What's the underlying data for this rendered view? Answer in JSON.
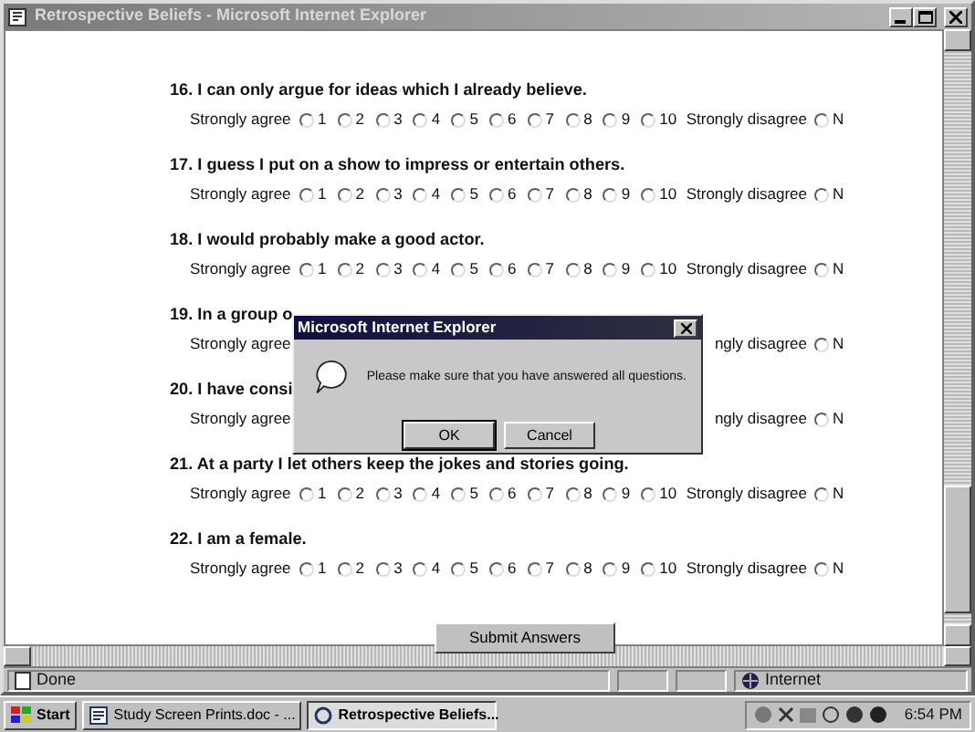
{
  "window": {
    "title": "Retrospective Beliefs - Microsoft Internet Explorer"
  },
  "questions": [
    {
      "heading": "16. I can only argue for ideas which I already believe.",
      "left_label": "Strongly agree",
      "options": [
        {
          "label": "1",
          "selected": false
        },
        {
          "label": "2",
          "selected": false
        },
        {
          "label": "3",
          "selected": false
        },
        {
          "label": "4",
          "selected": false
        },
        {
          "label": "5",
          "selected": false
        },
        {
          "label": "6",
          "selected": false
        },
        {
          "label": "7",
          "selected": false
        },
        {
          "label": "8",
          "selected": false
        },
        {
          "label": "9",
          "selected": false
        },
        {
          "label": "10",
          "selected": false
        }
      ],
      "right_label": "Strongly disagree",
      "extra_option": {
        "label": "N",
        "selected": false
      }
    },
    {
      "heading": "17. I guess I put on a show to impress or entertain others.",
      "left_label": "Strongly agree",
      "options": [
        {
          "label": "1",
          "selected": false
        },
        {
          "label": "2",
          "selected": false
        },
        {
          "label": "3",
          "selected": false
        },
        {
          "label": "4",
          "selected": false
        },
        {
          "label": "5",
          "selected": false
        },
        {
          "label": "6",
          "selected": false
        },
        {
          "label": "7",
          "selected": false
        },
        {
          "label": "8",
          "selected": false
        },
        {
          "label": "9",
          "selected": false
        },
        {
          "label": "10",
          "selected": false
        }
      ],
      "right_label": "Strongly disagree",
      "extra_option": {
        "label": "N",
        "selected": false
      }
    },
    {
      "heading": "18. I would probably make a good actor.",
      "left_label": "Strongly agree",
      "options": [
        {
          "label": "1",
          "selected": false
        },
        {
          "label": "2",
          "selected": false
        },
        {
          "label": "3",
          "selected": false
        },
        {
          "label": "4",
          "selected": false
        },
        {
          "label": "5",
          "selected": false
        },
        {
          "label": "6",
          "selected": false
        },
        {
          "label": "7",
          "selected": false
        },
        {
          "label": "8",
          "selected": false
        },
        {
          "label": "9",
          "selected": false
        },
        {
          "label": "10",
          "selected": false
        }
      ],
      "right_label": "Strongly disagree",
      "extra_option": {
        "label": "N",
        "selected": false
      }
    },
    {
      "heading": "19. In a group o",
      "left_label": "Strongly agree",
      "right_label": "ngly disagree",
      "extra_option": {
        "label": "N",
        "selected": false
      }
    },
    {
      "heading": "20. I have consi",
      "left_label": "Strongly agree",
      "right_label": "ngly disagree",
      "extra_option": {
        "label": "N",
        "selected": false
      }
    },
    {
      "heading": "21. At a party I let others keep the jokes and stories going.",
      "left_label": "Strongly agree",
      "options": [
        {
          "label": "1",
          "selected": false
        },
        {
          "label": "2",
          "selected": false
        },
        {
          "label": "3",
          "selected": false
        },
        {
          "label": "4",
          "selected": false
        },
        {
          "label": "5",
          "selected": false
        },
        {
          "label": "6",
          "selected": false
        },
        {
          "label": "7",
          "selected": false
        },
        {
          "label": "8",
          "selected": false
        },
        {
          "label": "9",
          "selected": false
        },
        {
          "label": "10",
          "selected": false
        }
      ],
      "right_label": "Strongly disagree",
      "extra_option": {
        "label": "N",
        "selected": false
      }
    },
    {
      "heading": "22. I am a female.",
      "left_label": "Strongly agree",
      "options": [
        {
          "label": "1",
          "selected": false
        },
        {
          "label": "2",
          "selected": false
        },
        {
          "label": "3",
          "selected": false
        },
        {
          "label": "4",
          "selected": false
        },
        {
          "label": "5",
          "selected": false
        },
        {
          "label": "6",
          "selected": false
        },
        {
          "label": "7",
          "selected": false
        },
        {
          "label": "8",
          "selected": false
        },
        {
          "label": "9",
          "selected": false
        },
        {
          "label": "10",
          "selected": false
        }
      ],
      "right_label": "Strongly disagree",
      "extra_option": {
        "label": "N",
        "selected": false
      }
    }
  ],
  "submit_button": "Submit Answers",
  "dialog": {
    "title": "Microsoft Internet Explorer",
    "message": "Please make sure that you have answered all questions.",
    "buttons": [
      {
        "label": "OK",
        "selected": true
      },
      {
        "label": "Cancel",
        "selected": false
      }
    ]
  },
  "status_bar": {
    "text": "Done",
    "zone": "Internet"
  },
  "taskbar": {
    "start": "Start",
    "tasks": [
      {
        "label": "Study Screen Prints.doc - ...",
        "selected": false
      },
      {
        "label": "Retrospective Beliefs...",
        "selected": true
      }
    ],
    "clock": "6:54 PM"
  }
}
